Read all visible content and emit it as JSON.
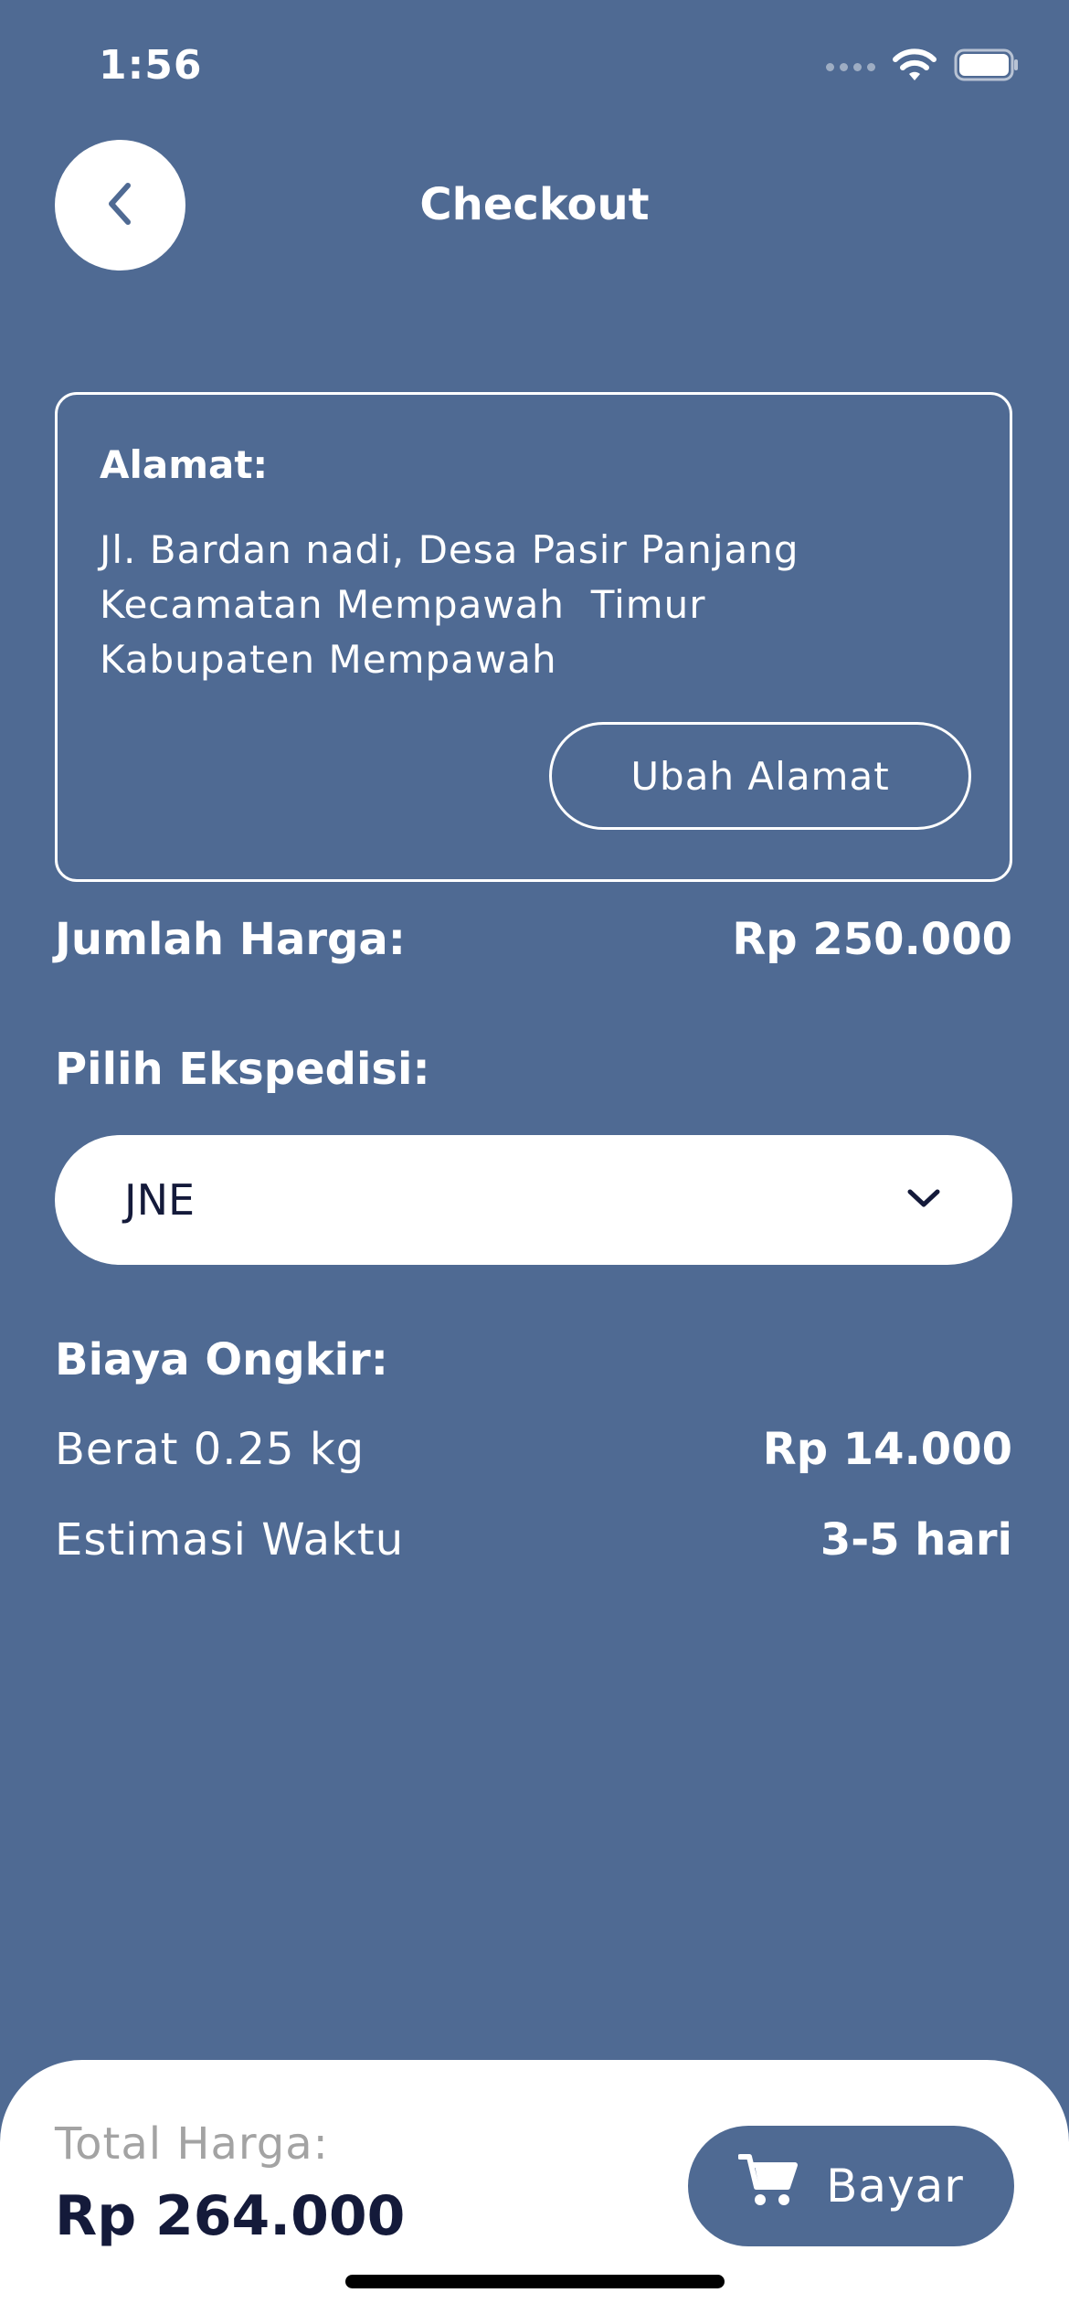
{
  "status_bar": {
    "time": "1:56",
    "signal_icon": "signal-dots-icon",
    "wifi_icon": "wifi-icon",
    "battery_icon": "battery-icon"
  },
  "header": {
    "back_icon": "chevron-left-icon",
    "title": "Checkout"
  },
  "address": {
    "label": "Alamat:",
    "lines": [
      "Jl. Bardan nadi, Desa Pasir Panjang",
      "Kecamatan Mempawah  Timur",
      "Kabupaten Mempawah"
    ],
    "change_button": "Ubah Alamat"
  },
  "price": {
    "label": "Jumlah Harga:",
    "value": "Rp 250.000"
  },
  "expedition": {
    "label": "Pilih Ekspedisi:",
    "selected": "JNE",
    "dropdown_icon": "chevron-down-icon"
  },
  "shipping": {
    "title": "Biaya Ongkir:",
    "weight_label": "Berat 0.25 kg",
    "weight_value": "Rp 14.000",
    "estimate_label": "Estimasi Waktu",
    "estimate_value": "3-5 hari"
  },
  "footer": {
    "total_label": "Total Harga:",
    "total_value": "Rp 264.000",
    "pay_button": "Bayar",
    "pay_icon": "cart-icon"
  },
  "colors": {
    "background": "#4f6a93",
    "dark_text": "#141a3a",
    "muted_text": "#a3a3a3",
    "surface": "#ffffff"
  }
}
